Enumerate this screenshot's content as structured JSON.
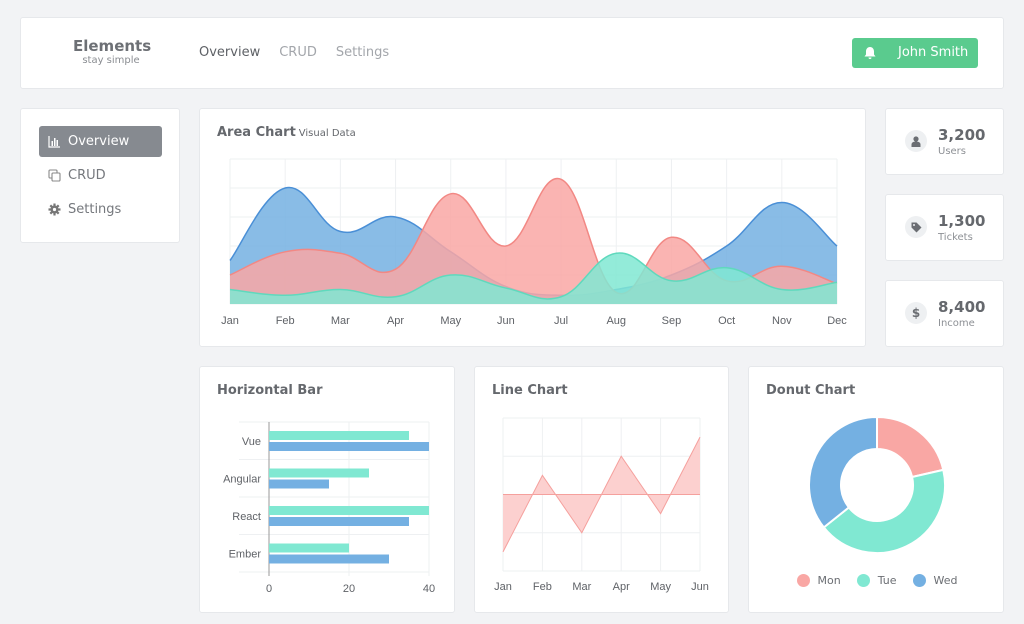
{
  "header": {
    "brand_title": "Elements",
    "brand_subtitle": "stay simple",
    "nav": [
      {
        "label": "Overview",
        "active": true
      },
      {
        "label": "CRUD",
        "active": false
      },
      {
        "label": "Settings",
        "active": false
      }
    ],
    "user_button": {
      "label": "John Smith",
      "icon": "bell-icon",
      "color": "#5acb8e"
    }
  },
  "sidebar": {
    "items": [
      {
        "label": "Overview",
        "icon": "bar-chart-icon",
        "active": true
      },
      {
        "label": "CRUD",
        "icon": "copy-icon",
        "active": false
      },
      {
        "label": "Settings",
        "icon": "gear-icon",
        "active": false
      }
    ]
  },
  "stats": [
    {
      "value": "3,200",
      "label": "Users",
      "icon": "user-icon"
    },
    {
      "value": "1,300",
      "label": "Tickets",
      "icon": "tag-icon"
    },
    {
      "value": "8,400",
      "label": "Income",
      "icon": "dollar-icon",
      "glyph": "$"
    }
  ],
  "colors": {
    "blue": "#74b0e2",
    "pink": "#f9a7a4",
    "teal": "#80e8d2"
  },
  "chart_data": [
    {
      "type": "area",
      "title": "Area Chart",
      "subtitle": "Visual Data",
      "grid": true,
      "categories": [
        "Jan",
        "Feb",
        "Mar",
        "Apr",
        "May",
        "Jun",
        "Jul",
        "Aug",
        "Sep",
        "Oct",
        "Nov",
        "Dec"
      ],
      "ylim": [
        0,
        5
      ],
      "series": [
        {
          "color": "#74b0e2",
          "stroke": "#4a8fd6",
          "values": [
            1.5,
            4.0,
            2.5,
            3.0,
            1.8,
            0.6,
            0.3,
            0.5,
            1.0,
            2.0,
            3.5,
            2.0
          ]
        },
        {
          "color": "#f9a7a4",
          "stroke": "#f28884",
          "values": [
            1.0,
            1.8,
            1.75,
            1.2,
            3.8,
            2.0,
            4.3,
            0.4,
            2.3,
            0.8,
            1.3,
            0.7
          ]
        },
        {
          "color": "#80e8d2",
          "stroke": "#5fd9bd",
          "values": [
            0.5,
            0.3,
            0.5,
            0.25,
            1.0,
            0.55,
            0.25,
            1.75,
            0.8,
            1.25,
            0.5,
            0.75
          ]
        }
      ]
    },
    {
      "type": "bar",
      "orientation": "horizontal",
      "title": "Horizontal Bar",
      "grid": true,
      "categories": [
        "Vue",
        "Angular",
        "React",
        "Ember"
      ],
      "xlim": [
        0,
        40
      ],
      "xticks": [
        "0",
        "20",
        "40"
      ],
      "series": [
        {
          "color": "#80e8d2",
          "values": [
            35,
            25,
            40,
            20
          ]
        },
        {
          "color": "#74b0e2",
          "values": [
            40,
            15,
            35,
            30
          ]
        }
      ]
    },
    {
      "type": "area",
      "title": "Line Chart",
      "grid": true,
      "categories": [
        "Jan",
        "Feb",
        "Mar",
        "Apr",
        "May",
        "Jun"
      ],
      "ylim": [
        -2,
        2
      ],
      "series": [
        {
          "color": "#fcd0cf",
          "stroke": "#f5a09d",
          "values": [
            -1.5,
            0.5,
            -1,
            1,
            -0.5,
            1.5
          ]
        }
      ]
    },
    {
      "type": "pie",
      "donut": true,
      "title": "Donut Chart",
      "legend": "bottom",
      "labels": [
        "Mon",
        "Tue",
        "Wed"
      ],
      "values": [
        30,
        60,
        50
      ],
      "colors": [
        "#f9a7a4",
        "#80e8d2",
        "#74b0e2"
      ]
    }
  ]
}
